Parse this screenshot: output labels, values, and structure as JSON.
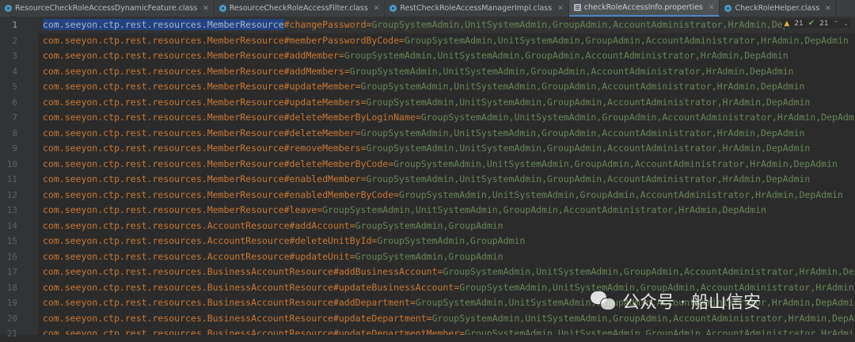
{
  "tabs": [
    {
      "label": "ResourceCheckRoleAccessDynamicFeature.class",
      "icon": "class-file-icon",
      "active": false
    },
    {
      "label": "ResourceCheckRoleAccessFilter.class",
      "icon": "class-file-icon",
      "active": false
    },
    {
      "label": "RestCheckRoleAccessManagerImpl.class",
      "icon": "class-file-icon",
      "active": false
    },
    {
      "label": "checkRoleAccessInfo.properties",
      "icon": "properties-file-icon",
      "active": true
    },
    {
      "label": "CheckRoleHelper.class",
      "icon": "class-file-icon",
      "active": false
    }
  ],
  "indicators": {
    "warnings": "21",
    "checks": "21"
  },
  "lines": [
    {
      "n": "1",
      "key": "com.seeyon.ctp.rest.resources.MemberResource#changePassword",
      "value": "GroupSystemAdmin,UnitSystemAdmin,GroupAdmin,AccountAdministrator,HrAdmin,DepAdmin"
    },
    {
      "n": "2",
      "key": "com.seeyon.ctp.rest.resources.MemberResource#memberPasswordByCode",
      "value": "GroupSystemAdmin,UnitSystemAdmin,GroupAdmin,AccountAdministrator,HrAdmin,DepAdmin"
    },
    {
      "n": "3",
      "key": "com.seeyon.ctp.rest.resources.MemberResource#addMember",
      "value": "GroupSystemAdmin,UnitSystemAdmin,GroupAdmin,AccountAdministrator,HrAdmin,DepAdmin"
    },
    {
      "n": "4",
      "key": "com.seeyon.ctp.rest.resources.MemberResource#addMembers",
      "value": "GroupSystemAdmin,UnitSystemAdmin,GroupAdmin,AccountAdministrator,HrAdmin,DepAdmin"
    },
    {
      "n": "5",
      "key": "com.seeyon.ctp.rest.resources.MemberResource#updateMember",
      "value": "GroupSystemAdmin,UnitSystemAdmin,GroupAdmin,AccountAdministrator,HrAdmin,DepAdmin"
    },
    {
      "n": "6",
      "key": "com.seeyon.ctp.rest.resources.MemberResource#updateMembers",
      "value": "GroupSystemAdmin,UnitSystemAdmin,GroupAdmin,AccountAdministrator,HrAdmin,DepAdmin"
    },
    {
      "n": "7",
      "key": "com.seeyon.ctp.rest.resources.MemberResource#deleteMemberByLoginName",
      "value": "GroupSystemAdmin,UnitSystemAdmin,GroupAdmin,AccountAdministrator,HrAdmin,DepAdmin"
    },
    {
      "n": "8",
      "key": "com.seeyon.ctp.rest.resources.MemberResource#deleteMember",
      "value": "GroupSystemAdmin,UnitSystemAdmin,GroupAdmin,AccountAdministrator,HrAdmin,DepAdmin"
    },
    {
      "n": "9",
      "key": "com.seeyon.ctp.rest.resources.MemberResource#removeMembers",
      "value": "GroupSystemAdmin,UnitSystemAdmin,GroupAdmin,AccountAdministrator,HrAdmin,DepAdmin"
    },
    {
      "n": "10",
      "key": "com.seeyon.ctp.rest.resources.MemberResource#deleteMemberByCode",
      "value": "GroupSystemAdmin,UnitSystemAdmin,GroupAdmin,AccountAdministrator,HrAdmin,DepAdmin"
    },
    {
      "n": "11",
      "key": "com.seeyon.ctp.rest.resources.MemberResource#enabledMember",
      "value": "GroupSystemAdmin,UnitSystemAdmin,GroupAdmin,AccountAdministrator,HrAdmin,DepAdmin"
    },
    {
      "n": "12",
      "key": "com.seeyon.ctp.rest.resources.MemberResource#enabledMemberByCode",
      "value": "GroupSystemAdmin,UnitSystemAdmin,GroupAdmin,AccountAdministrator,HrAdmin,DepAdmin"
    },
    {
      "n": "13",
      "key": "com.seeyon.ctp.rest.resources.MemberResource#leave",
      "value": "GroupSystemAdmin,UnitSystemAdmin,GroupAdmin,AccountAdministrator,HrAdmin,DepAdmin"
    },
    {
      "n": "14",
      "key": "com.seeyon.ctp.rest.resources.AccountResource#addAccount",
      "value": "GroupSystemAdmin,GroupAdmin"
    },
    {
      "n": "15",
      "key": "com.seeyon.ctp.rest.resources.AccountResource#deleteUnitById",
      "value": "GroupSystemAdmin,GroupAdmin"
    },
    {
      "n": "16",
      "key": "com.seeyon.ctp.rest.resources.AccountResource#updateUnit",
      "value": "GroupSystemAdmin,GroupAdmin"
    },
    {
      "n": "17",
      "key": "com.seeyon.ctp.rest.resources.BusinessAccountResource#addBusinessAccount",
      "value": "GroupSystemAdmin,UnitSystemAdmin,GroupAdmin,AccountAdministrator,HrAdmin,DepAdmin"
    },
    {
      "n": "18",
      "key": "com.seeyon.ctp.rest.resources.BusinessAccountResource#updateBusinessAccount",
      "value": "GroupSystemAdmin,UnitSystemAdmin,GroupAdmin,AccountAdministrator,HrAdmin,DepAdmin"
    },
    {
      "n": "19",
      "key": "com.seeyon.ctp.rest.resources.BusinessAccountResource#addDepartment",
      "value": "GroupSystemAdmin,UnitSystemAdmin,GroupAdmin,AccountAdministrator,HrAdmin,DepAdmin"
    },
    {
      "n": "20",
      "key": "com.seeyon.ctp.rest.resources.BusinessAccountResource#updateDepartment",
      "value": "GroupSystemAdmin,UnitSystemAdmin,GroupAdmin,AccountAdministrator,HrAdmin,DepAdmin"
    },
    {
      "n": "21",
      "key": "com.seeyon.ctp.rest.resources.BusinessAccountResource#updateDepartmentMember",
      "value": "GroupSystemAdmin,UnitSystemAdmin,GroupAdmin,AccountAdministrator,HrAdmin,DepAdmin"
    }
  ],
  "selection": "com.seeyon.ctp.rest.resources.MemberResource",
  "watermark": "公众号 · 船山信安"
}
